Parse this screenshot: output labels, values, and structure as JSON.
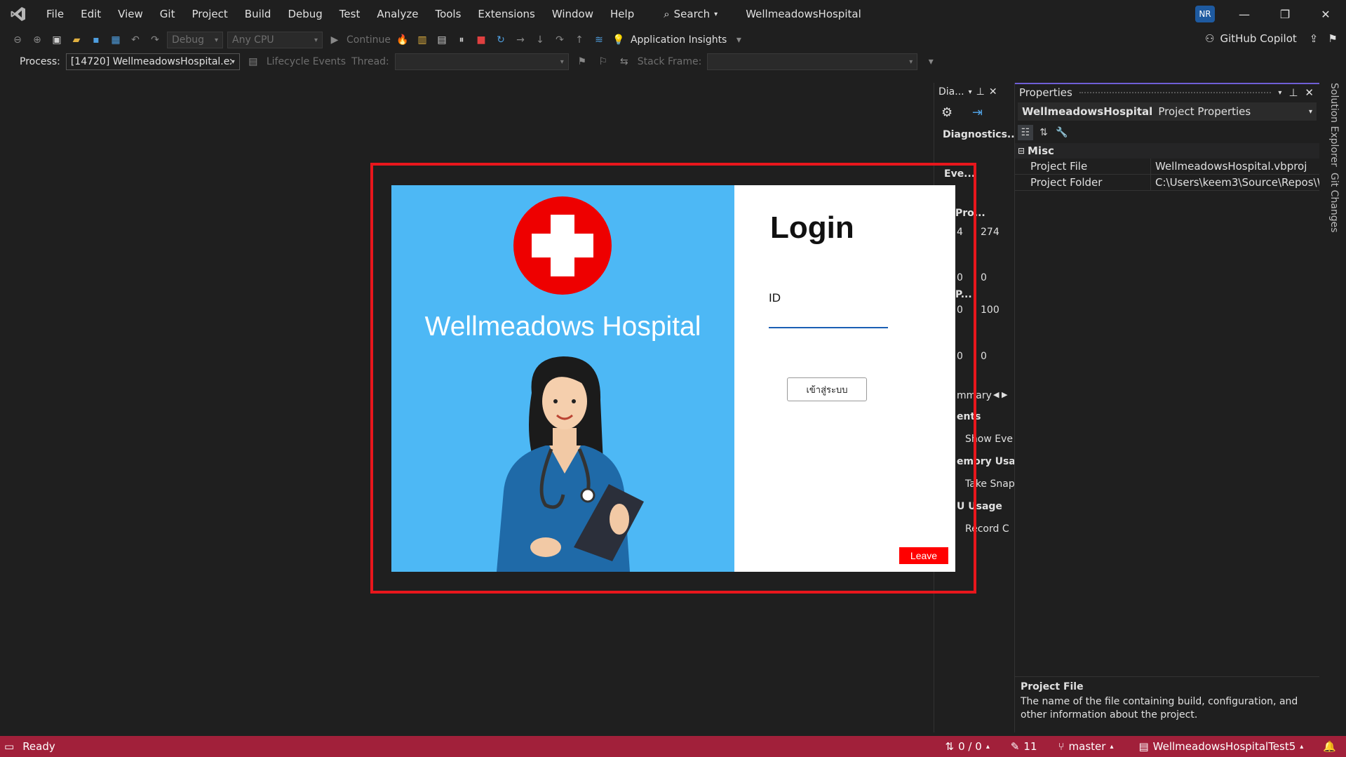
{
  "window": {
    "title": "WellmeadowsHospital",
    "avatar_initials": "NR",
    "minimize": "—",
    "restore": "❐",
    "close": "✕"
  },
  "menu": [
    "File",
    "Edit",
    "View",
    "Git",
    "Project",
    "Build",
    "Debug",
    "Test",
    "Analyze",
    "Tools",
    "Extensions",
    "Window",
    "Help"
  ],
  "search": {
    "label": "Search"
  },
  "toolbar": {
    "config": "Debug",
    "platform": "Any CPU",
    "continue_label": "Continue",
    "app_insights": "Application Insights",
    "copilot": "GitHub Copilot"
  },
  "debug_toolbar": {
    "process_label": "Process:",
    "process_value": "[14720] WellmeadowsHospital.exe",
    "lifecycle": "Lifecycle Events",
    "thread_label": "Thread:",
    "stack_label": "Stack Frame:"
  },
  "diagnostics": {
    "tab_title": "Dia...",
    "header": "Diagnostics...",
    "events": "Eve...",
    "process": "Pro...",
    "v1": "274",
    "v2": "0",
    "v3": "100",
    "v4": "0",
    "left1": "4",
    "left2": "0",
    "left3": "0",
    "left4": "0",
    "cpu_short": "P...",
    "summary": "mmary",
    "events2": "ents",
    "show_events": "Show Eve",
    "memory": "emory Usag",
    "take_snapshot": "Take Snap",
    "cpu": "U Usage",
    "record": "Record C"
  },
  "properties": {
    "title": "Properties",
    "object_name": "WellmeadowsHospital",
    "object_type": "Project Properties",
    "category": "Misc",
    "rows": [
      {
        "name": "Project File",
        "value": "WellmeadowsHospital.vbproj"
      },
      {
        "name": "Project Folder",
        "value": "C:\\Users\\keem3\\Source\\Repos\\W"
      }
    ],
    "desc_title": "Project File",
    "desc_text": "The name of the file containing build, configuration, and other information about the project."
  },
  "side_tabs": [
    "Solution Explorer",
    "Git Changes"
  ],
  "status": {
    "ready": "Ready",
    "changes": "0 / 0",
    "edits": "11",
    "branch": "master",
    "repo": "WellmeadowsHospitalTest5"
  },
  "form": {
    "hospital_name": "Wellmeadows Hospital",
    "login_title": "Login",
    "id_label": "ID",
    "id_value": "",
    "login_button": "เข้าสู่ระบบ",
    "leave_button": "Leave"
  },
  "colors": {
    "status_bar": "#a1203a",
    "panel_blue": "#4db8f5",
    "highlight_red": "#e8161c",
    "leave_red": "#ff0000",
    "accent_purple": "#6f5fd6"
  }
}
